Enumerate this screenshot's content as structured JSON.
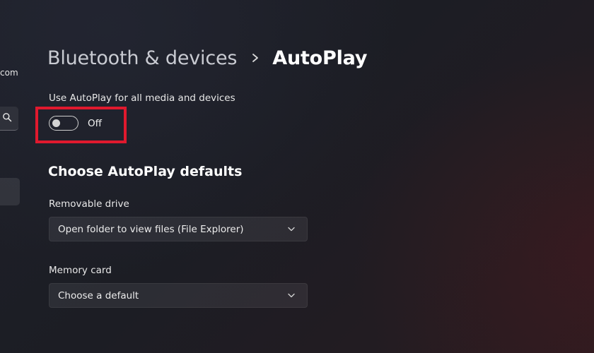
{
  "sidebar": {
    "account_fragment": "com"
  },
  "header": {
    "breadcrumb_parent": "Bluetooth & devices",
    "breadcrumb_current": "AutoPlay"
  },
  "autoplay_toggle": {
    "label": "Use AutoPlay for all media and devices",
    "state_text": "Off",
    "on": false,
    "highlight_color": "#e0192e"
  },
  "defaults": {
    "title": "Choose AutoPlay defaults",
    "removable_drive": {
      "label": "Removable drive",
      "selected": "Open folder to view files (File Explorer)"
    },
    "memory_card": {
      "label": "Memory card",
      "selected": "Choose a default"
    }
  },
  "icons": {
    "search": "search-icon",
    "breadcrumb_separator": "chevron-right-icon",
    "dropdown": "chevron-down-icon"
  }
}
